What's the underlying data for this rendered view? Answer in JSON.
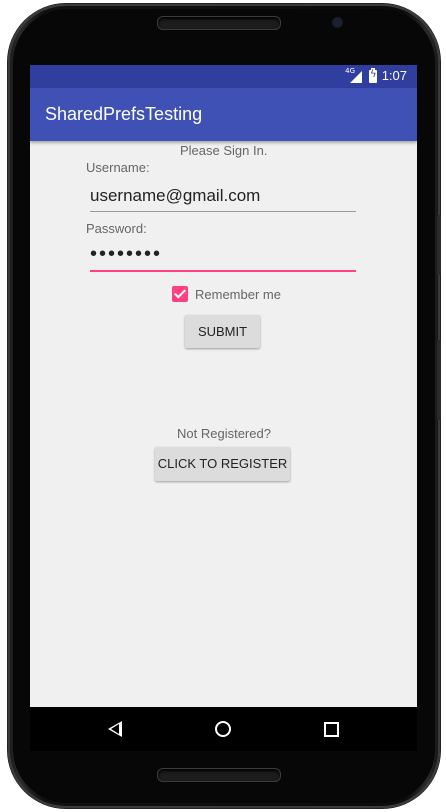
{
  "status_bar": {
    "time": "1:07",
    "network": "4G"
  },
  "app_bar": {
    "title": "SharedPrefsTesting"
  },
  "form": {
    "prompt": "Please Sign In.",
    "username_label": "Username:",
    "username_value": "username@gmail.com",
    "password_label": "Password:",
    "password_value": "••••••••",
    "remember_label": "Remember me",
    "remember_checked": true,
    "submit_label": "SUBMIT"
  },
  "register": {
    "prompt": "Not Registered?",
    "button_label": "CLICK TO REGISTER"
  },
  "nav_bar": {
    "back_icon": "back-icon",
    "home_icon": "home-icon",
    "recents_icon": "recents-icon"
  },
  "colors": {
    "status_bar": "#303f9f",
    "app_bar": "#3f51b5",
    "accent": "#ff4081",
    "background": "#f0f0f0"
  }
}
